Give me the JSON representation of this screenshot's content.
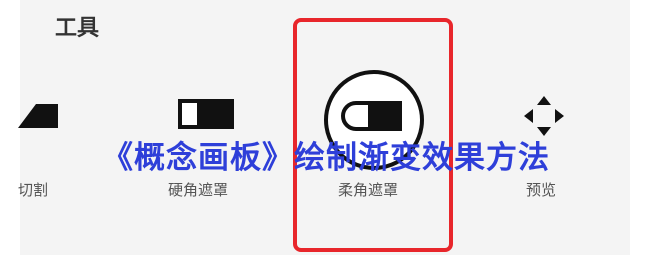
{
  "panel": {
    "title": "工具"
  },
  "tools": [
    {
      "label": "切割",
      "icon": "cut-wedge-icon"
    },
    {
      "label": "硬角遮罩",
      "icon": "hard-mask-icon"
    },
    {
      "label": "柔角遮罩",
      "icon": "soft-mask-icon",
      "selected": true
    },
    {
      "label": "预览",
      "icon": "move-arrows-icon"
    }
  ],
  "overlay_title": "《概念画板》绘制渐变效果方法",
  "colors": {
    "overlay_text": "#2e3fd9",
    "highlight_border": "#e8262b",
    "panel_bg": "#f4f4f4"
  }
}
